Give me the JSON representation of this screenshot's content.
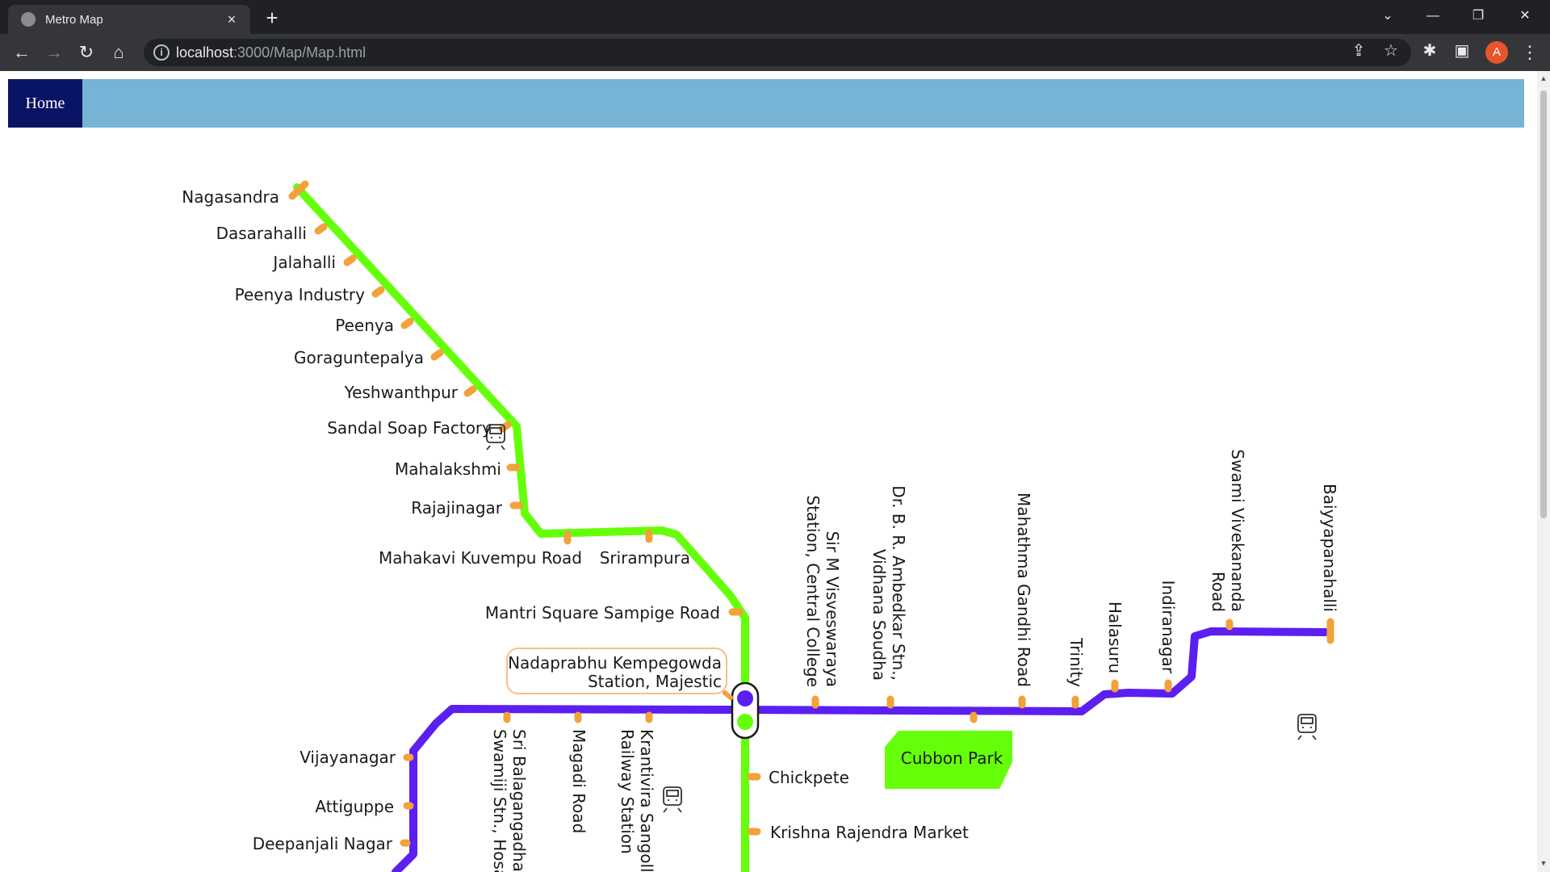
{
  "browser": {
    "tab_title": "Metro Map",
    "tab_close": "×",
    "new_tab": "+",
    "url_host": "localhost",
    "url_path": ":3000/Map/Map.html",
    "avatar_letter": "A",
    "icons": {
      "back": "back-arrow-icon",
      "forward": "forward-arrow-icon",
      "reload": "reload-icon",
      "home": "home-icon",
      "info": "info-icon",
      "share": "share-icon",
      "bookmark": "star-icon",
      "extensions": "puzzle-icon",
      "side_panel": "side-panel-icon",
      "menu": "kebab-menu-icon",
      "tab_search": "chevron-down-icon",
      "minimize": "minimize-icon",
      "restore": "restore-icon",
      "close": "close-icon"
    }
  },
  "nav": {
    "home_label": "Home"
  },
  "map": {
    "colors": {
      "green_line": "#66ff0a",
      "purple_line": "#5b1ff0",
      "station_tick": "#f3a13b",
      "park": "#66ff0a",
      "interchange_border": "#f3c08a"
    },
    "green_stations": [
      "Nagasandra",
      "Dasarahalli",
      "Jalahalli",
      "Peenya Industry",
      "Peenya",
      "Goraguntepalya",
      "Yeshwanthpur",
      "Sandal Soap Factory",
      "Mahalakshmi",
      "Rajajinagar",
      "Mahakavi Kuvempu Road",
      "Srirampura",
      "Mantri Square Sampige Road",
      "Chickpete",
      "Krishna Rajendra Market"
    ],
    "interchange": {
      "line1": "Nadaprabhu Kempegowda",
      "line2": "Station, Majestic"
    },
    "purple_east_stations": [
      {
        "line1": "Sir M Visveswaraya",
        "line2": "Station, Central College"
      },
      {
        "line1": "Dr. B. R. Ambedkar Stn.,",
        "line2": "Vidhana Soudha"
      },
      {
        "line1": "Mahathma Gandhi Road",
        "line2": ""
      },
      {
        "line1": "Trinity",
        "line2": ""
      },
      {
        "line1": "Halasuru",
        "line2": ""
      },
      {
        "line1": "Indiranagar",
        "line2": ""
      },
      {
        "line1": "Swami Vivekananda",
        "line2": "Road"
      },
      {
        "line1": "Baiyyapanahalli",
        "line2": ""
      }
    ],
    "purple_west_stations": [
      "Vijayanagar",
      "Attiguppe",
      "Deepanjali Nagar"
    ],
    "purple_center_stations": [
      {
        "line1": "Sri Balagangadhar",
        "line2": "Swamiji Stn., Hosa"
      },
      {
        "line1": "Magadi Road",
        "line2": ""
      },
      {
        "line1": "Krantivira Sangolli",
        "line2": "Railway Station"
      }
    ],
    "park_label": "Cubbon Park",
    "depot_icon": "train-depot-icon"
  }
}
